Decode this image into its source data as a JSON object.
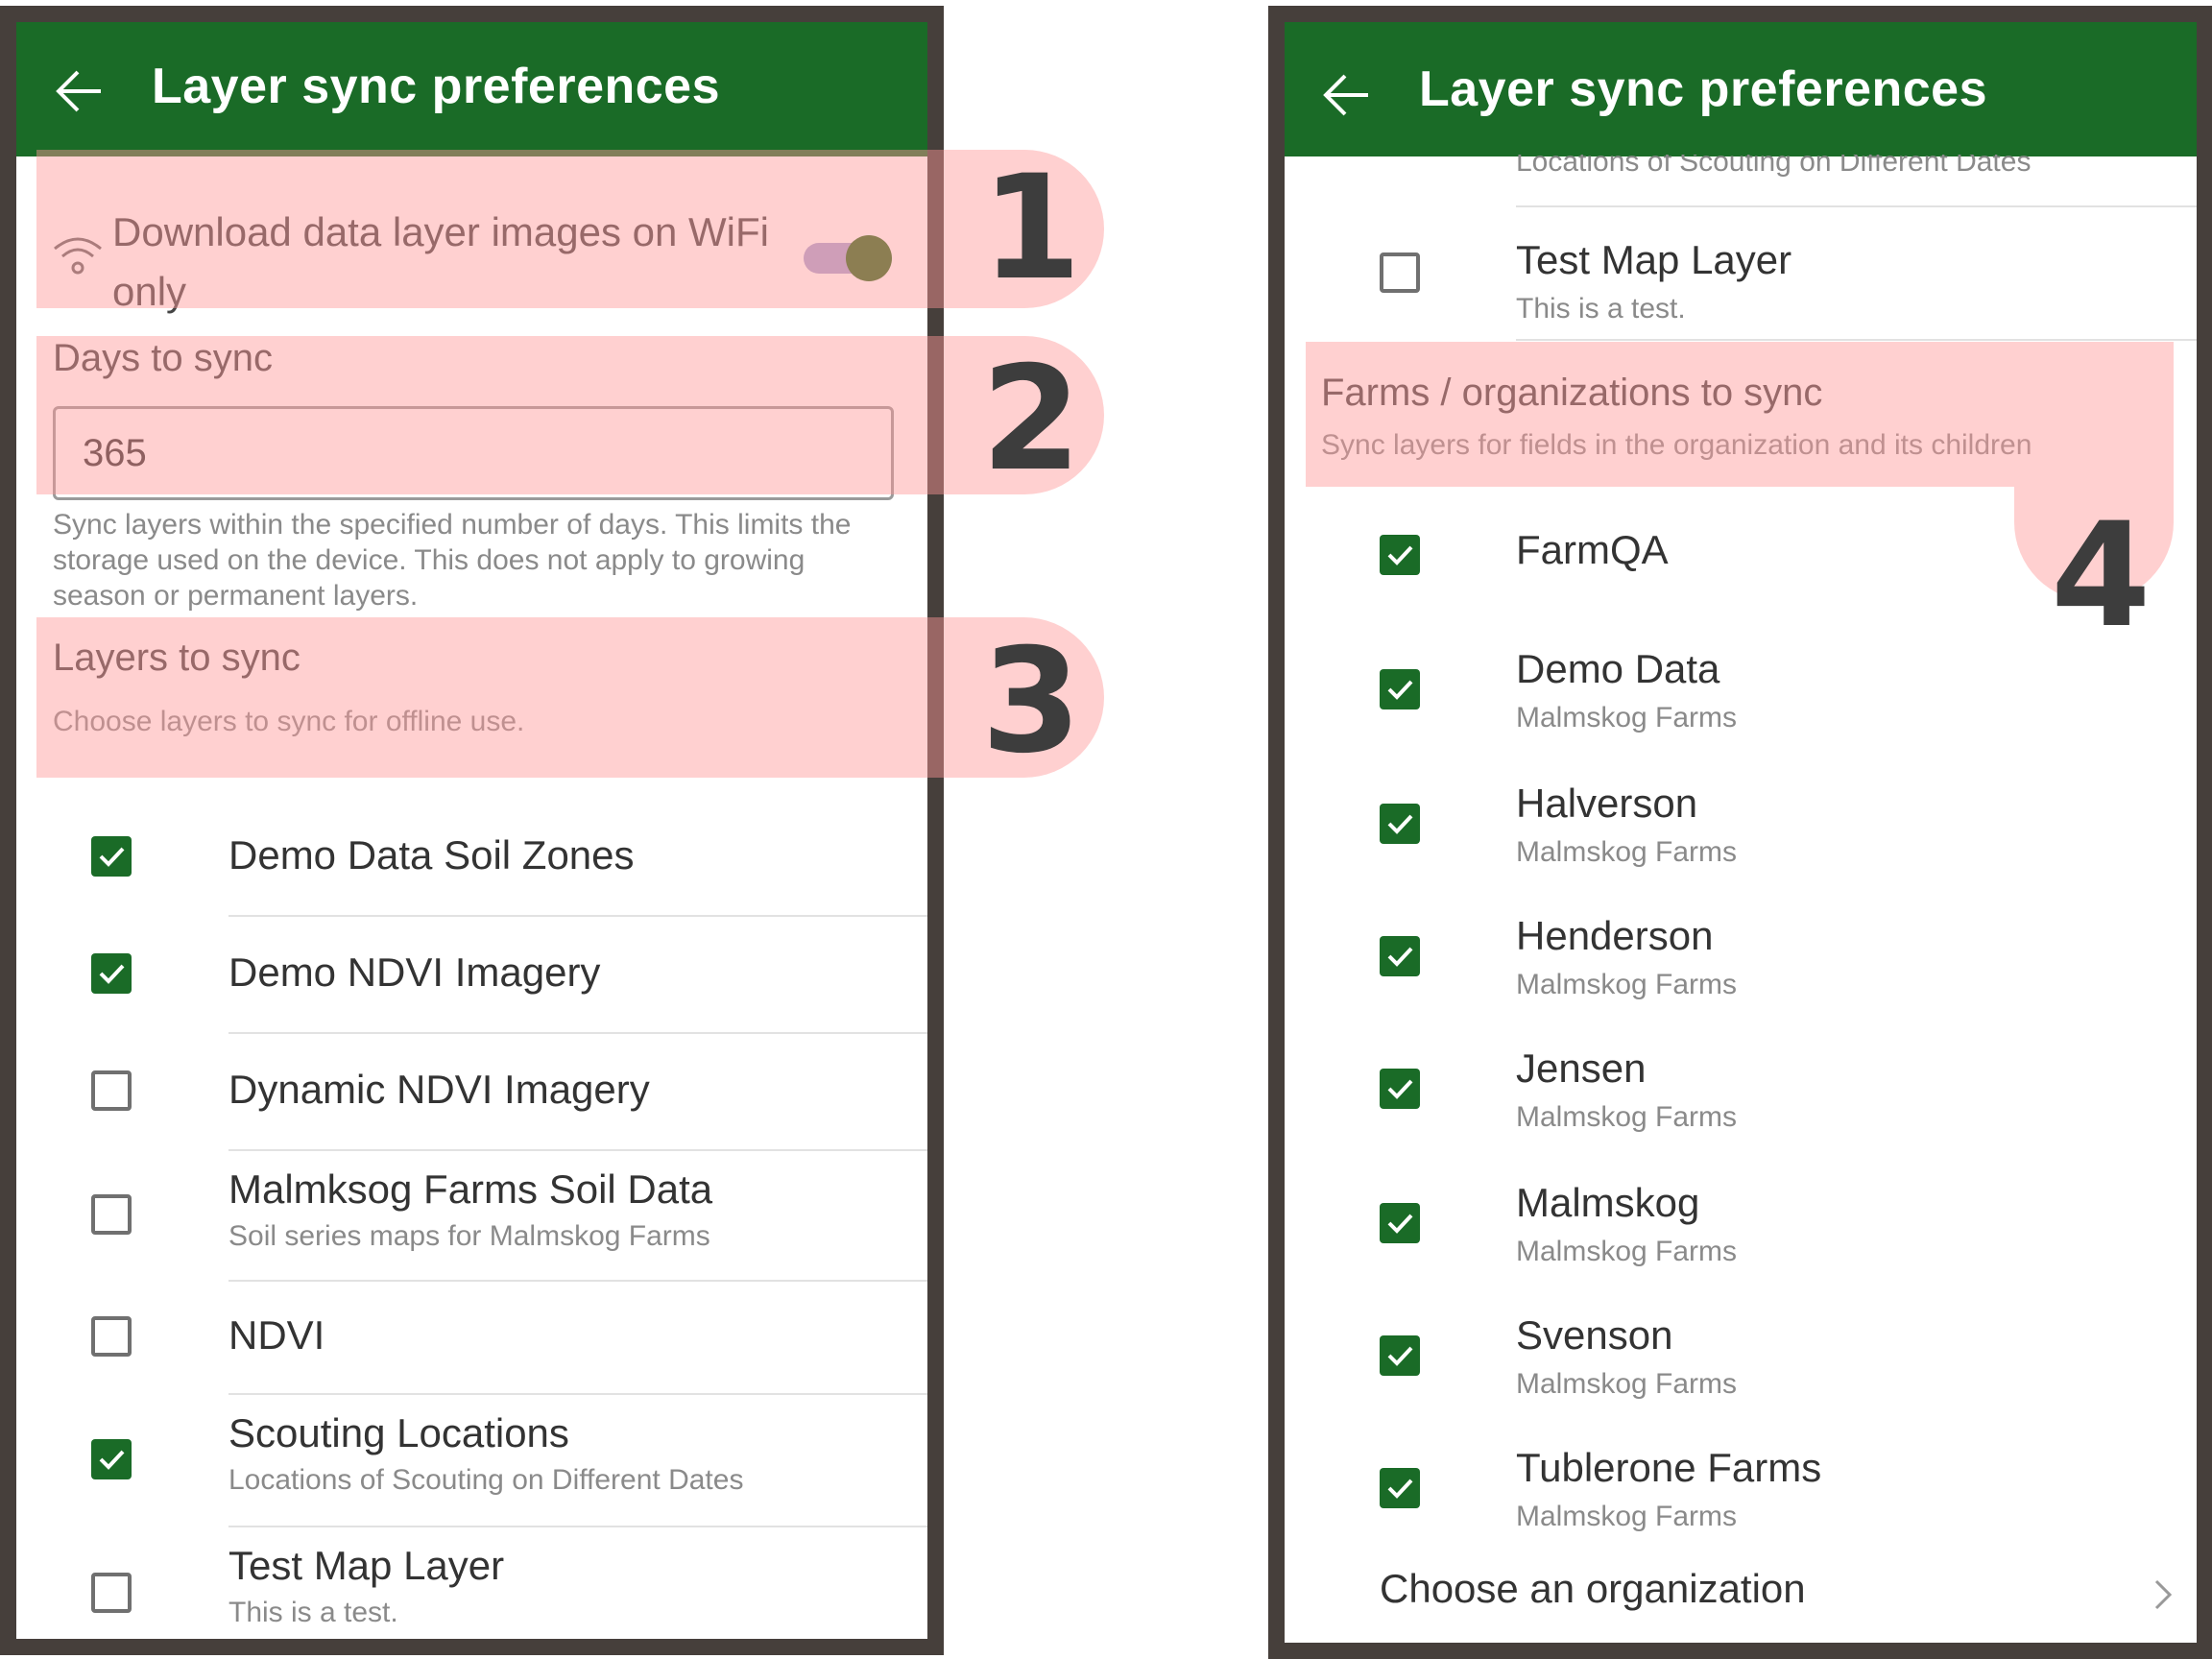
{
  "left_screen": {
    "title": "Layer sync preferences",
    "wifi_label": "Download data layer images on WiFi only",
    "wifi_enabled": true,
    "days_label": "Days to sync",
    "days_value": "365",
    "days_help": "Sync layers within the specified number of days. This limits the storage used on the device. This does not apply to growing season or permanent layers.",
    "layers_title": "Layers to sync",
    "layers_subtitle": "Choose layers to sync for offline use.",
    "layers": [
      {
        "name": "Demo Data Soil Zones",
        "desc": "",
        "checked": true
      },
      {
        "name": "Demo NDVI Imagery",
        "desc": "",
        "checked": true
      },
      {
        "name": "Dynamic NDVI Imagery",
        "desc": "",
        "checked": false
      },
      {
        "name": "Malmksog Farms Soil Data",
        "desc": "Soil series maps for Malmskog Farms",
        "checked": false
      },
      {
        "name": "NDVI",
        "desc": "",
        "checked": false
      },
      {
        "name": "Scouting Locations",
        "desc": "Locations of Scouting on Different Dates",
        "checked": true
      },
      {
        "name": "Test Map Layer",
        "desc": "This is a test.",
        "checked": false
      }
    ]
  },
  "right_screen": {
    "title": "Layer sync preferences",
    "partial_text": "Locations of Scouting on Different Dates",
    "test_layer": {
      "name": "Test Map Layer",
      "desc": "This is a test.",
      "checked": false
    },
    "farms_title": "Farms / organizations to sync",
    "farms_subtitle": "Sync layers for fields in the organization and its children",
    "farms": [
      {
        "name": "FarmQA",
        "org": "",
        "checked": true
      },
      {
        "name": "Demo Data",
        "org": "Malmskog Farms",
        "checked": true
      },
      {
        "name": "Halverson",
        "org": "Malmskog Farms",
        "checked": true
      },
      {
        "name": "Henderson",
        "org": "Malmskog Farms",
        "checked": true
      },
      {
        "name": "Jensen",
        "org": "Malmskog Farms",
        "checked": true
      },
      {
        "name": "Malmskog",
        "org": "Malmskog Farms",
        "checked": true
      },
      {
        "name": "Svenson",
        "org": "Malmskog Farms",
        "checked": true
      },
      {
        "name": "Tublerone Farms",
        "org": "Malmskog Farms",
        "checked": true
      }
    ],
    "choose_org": "Choose an organization"
  },
  "markers": [
    "1",
    "2",
    "3",
    "4"
  ],
  "colors": {
    "appbar": "#1a6b27",
    "frame": "#463f3b",
    "checkbox_checked": "#1a6b27",
    "highlight": "#ff9696",
    "toggle_track": "#a8a4d3",
    "toggle_knob": "#2f6a1b"
  }
}
